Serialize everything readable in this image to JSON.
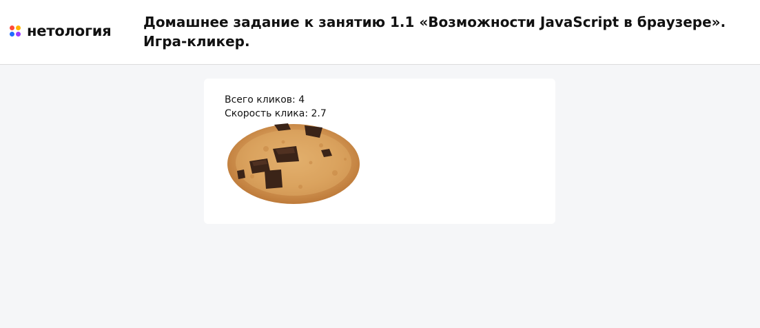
{
  "header": {
    "logo_text": "нетология",
    "logo_colors": [
      "#ff4b3a",
      "#ffb400",
      "#1f6bff",
      "#9b39ff"
    ],
    "title": "Домашнее задание к занятию 1.1 «Возможности JavaScript в браузере». Игра-кликер."
  },
  "game": {
    "clicks_label": "Всего кликов: ",
    "clicks_value": "4",
    "speed_label": "Скорость клика: ",
    "speed_value": "2.7"
  }
}
